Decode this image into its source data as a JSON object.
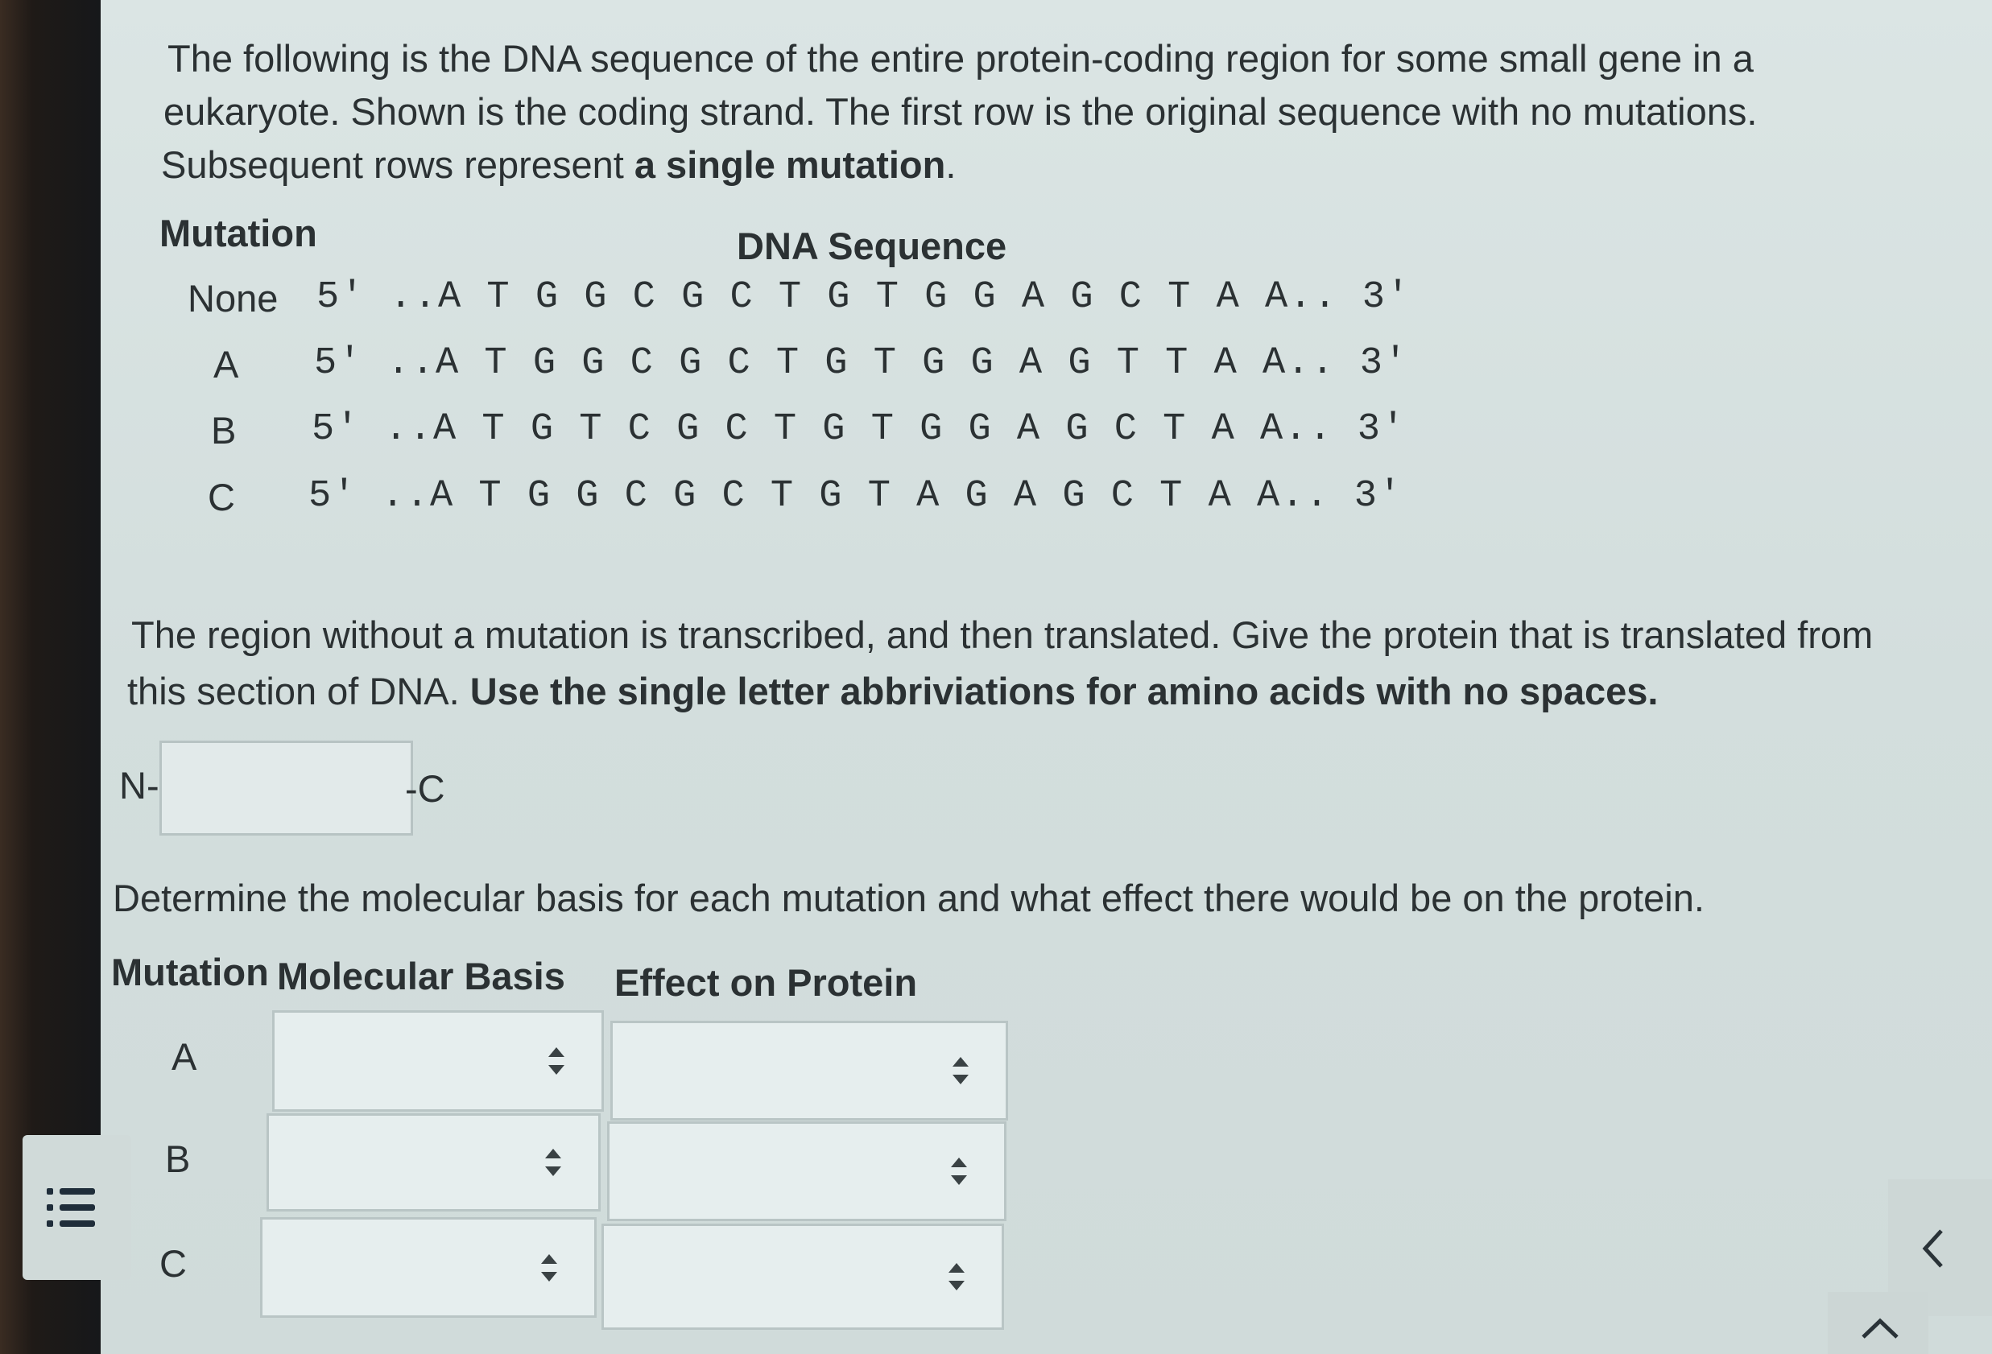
{
  "intro": {
    "line1": "The following is the DNA sequence of the entire protein-coding region for some small gene in a",
    "line2": "eukaryote.  Shown is the coding strand.  The first row is the original sequence with no mutations.",
    "line3_prefix": "Subsequent rows represent ",
    "line3_bold": "a single mutation",
    "line3_suffix": "."
  },
  "sequence_table": {
    "col_mutation": "Mutation",
    "col_sequence": "DNA Sequence",
    "rows": [
      {
        "label": "None",
        "sequence": "5′ ..A T G G C G C T G T G G A G C T A A.. 3′"
      },
      {
        "label": "A",
        "sequence": "5′ ..A T G G C G C T G T G G A G T T A A.. 3′"
      },
      {
        "label": "B",
        "sequence": "5′ ..A T G T C G C T G T G G A G C T A A.. 3′"
      },
      {
        "label": "C",
        "sequence": "5′ ..A T G G C G C T G T A G A G C T A A.. 3′"
      }
    ]
  },
  "question1": {
    "line1": "The region without a mutation is transcribed, and then translated.  Give the protein that is translated from",
    "line2_prefix": "this section of DNA.  ",
    "line2_bold": "Use the single letter abbriviations for amino acids with no spaces.",
    "prefix": "N-",
    "suffix": "-C",
    "answer_value": ""
  },
  "question2": {
    "text": "Determine the molecular basis for each mutation and what effect there would be on the protein.",
    "col_mutation": "Mutation",
    "col_basis": "Molecular Basis",
    "col_effect": "Effect on Protein",
    "rows": [
      {
        "label": "A",
        "basis": "",
        "effect": ""
      },
      {
        "label": "B",
        "basis": "",
        "effect": ""
      },
      {
        "label": "C",
        "basis": "",
        "effect": ""
      }
    ]
  },
  "icons": {
    "menu": "list-menu-icon",
    "collapse": "chevron-left-icon",
    "scroll_up": "chevron-up-icon"
  }
}
